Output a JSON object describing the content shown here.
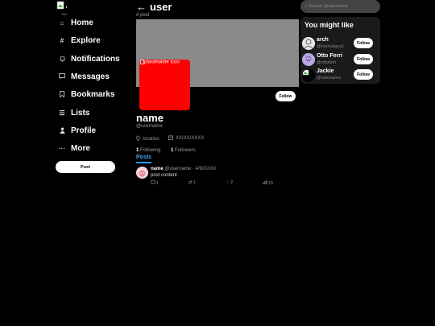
{
  "nav": {
    "logo_alt": "",
    "items": [
      {
        "label": "Home",
        "icon": "home-icon",
        "glyph": "⌂"
      },
      {
        "label": "Explore",
        "icon": "hash-icon",
        "glyph": "#"
      },
      {
        "label": "Notifications",
        "icon": "bell-icon",
        "glyph": "🔔"
      },
      {
        "label": "Messages",
        "icon": "message-icon",
        "glyph": "▭"
      },
      {
        "label": "Bookmarks",
        "icon": "bookmark-icon",
        "glyph": "⌷"
      },
      {
        "label": "Lists",
        "icon": "list-icon",
        "glyph": "☰"
      },
      {
        "label": "Profile",
        "icon": "person-icon",
        "glyph": "👤"
      },
      {
        "label": "More",
        "icon": "more-icon",
        "glyph": "···"
      }
    ],
    "post_button": "Post"
  },
  "header": {
    "back_glyph": "←",
    "title": "user",
    "subtitle": "# post"
  },
  "profile": {
    "avatar_alt": "placeholder icon",
    "follow_button": "Follow",
    "name": "name",
    "handle": "@username",
    "location": "location",
    "date": "XX/XX/XXXX",
    "following_count": "1",
    "following_label": "Following",
    "followers_count": "1",
    "followers_label": "Followers",
    "tab": "Posts"
  },
  "post": {
    "name": "name",
    "handle": "@username",
    "date": "· 4/9/XXXX",
    "content": "post content",
    "replies": "1",
    "reposts": "1",
    "likes": "2",
    "views": "15"
  },
  "search": {
    "placeholder": "Search @username"
  },
  "suggestions": {
    "title": "You might like",
    "items": [
      {
        "name": "arch",
        "handle": "@normalguy1",
        "follow": "Follow"
      },
      {
        "name": "Otto Ferri",
        "handle": "@ottoferri",
        "follow": "Follow"
      },
      {
        "name": "Jackie",
        "handle": "@username",
        "follow": "Follow"
      }
    ]
  },
  "colors": {
    "accent": "#1d9bf0",
    "avatar": "#ff0000",
    "banner": "#8a8a8a",
    "background": "#000000"
  }
}
